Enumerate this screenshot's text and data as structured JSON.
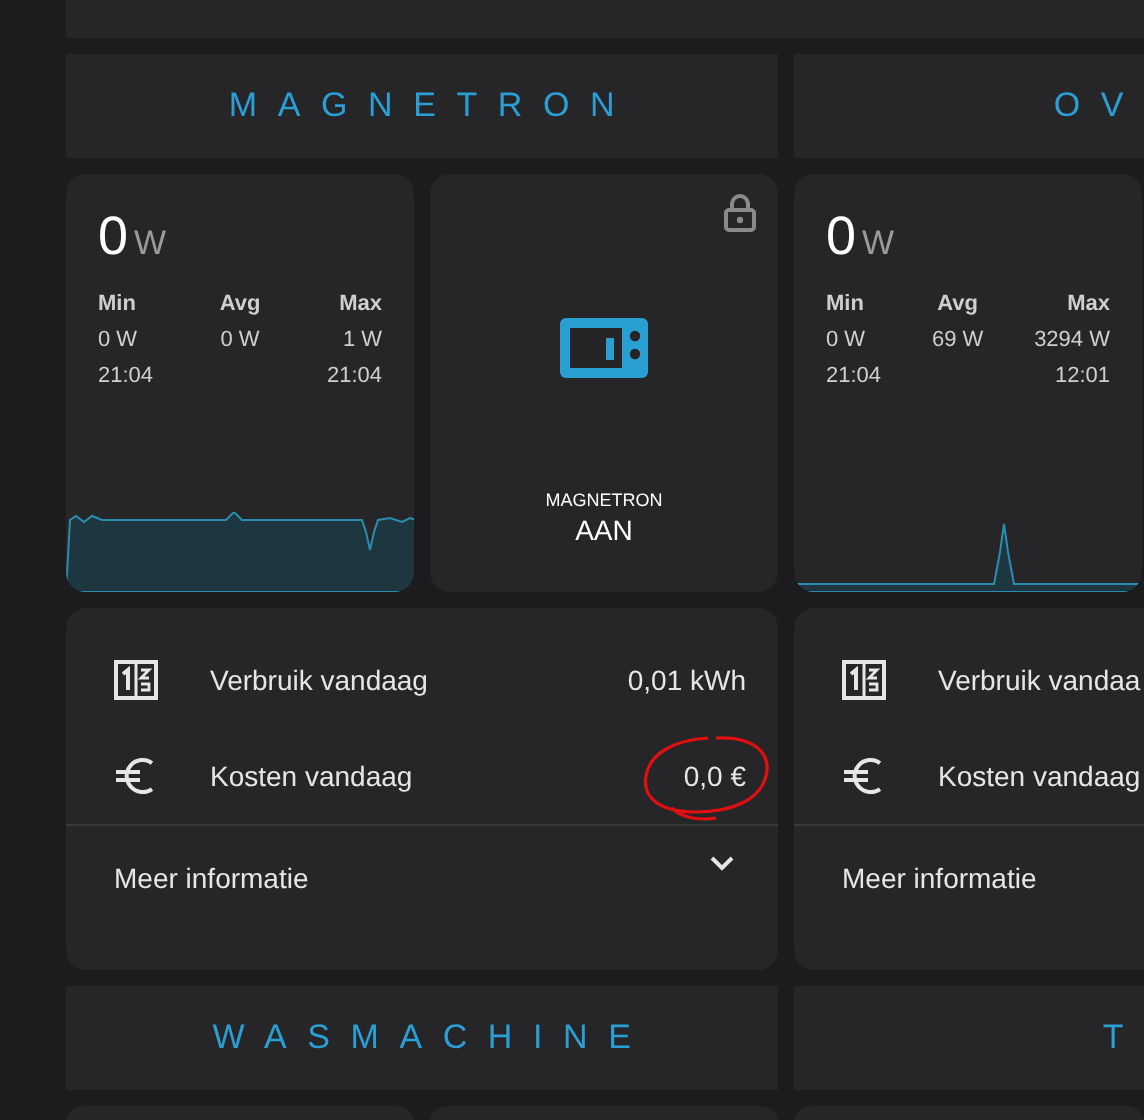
{
  "columns": [
    {
      "header": "MAGNETRON",
      "sensor": {
        "value": "0",
        "unit": "W",
        "graph": {
          "kind": "plateau"
        },
        "stats": [
          {
            "label": "Min",
            "value": "0 W",
            "time": "21:04"
          },
          {
            "label": "Avg",
            "value": "0 W"
          },
          {
            "label": "Max",
            "value": "1 W",
            "time": "21:04"
          }
        ]
      },
      "switch": {
        "name": "MAGNETRON",
        "state": "AAN",
        "on": true,
        "locked": true
      },
      "rows": [
        {
          "kind": "counter",
          "label": "Verbruik vandaag",
          "value": "0,01 kWh"
        },
        {
          "kind": "euro",
          "label": "Kosten vandaag",
          "value": "0,0 €",
          "circled": true
        }
      ],
      "more": "Meer informatie",
      "expanded": false
    },
    {
      "header": "OV",
      "sensor": {
        "value": "0",
        "unit": "W",
        "graph": {
          "kind": "spike"
        },
        "stats": [
          {
            "label": "Min",
            "value": "0 W",
            "time": "21:04"
          },
          {
            "label": "Avg",
            "value": "69 W"
          },
          {
            "label": "Max",
            "value": "3294 W",
            "time": "12:01"
          }
        ]
      },
      "rows": [
        {
          "kind": "counter",
          "label": "Verbruik vandaa"
        },
        {
          "kind": "euro",
          "label": "Kosten vandaag"
        }
      ],
      "more": "Meer informatie"
    }
  ],
  "next_headers": [
    "WASMACHINE",
    "T"
  ]
}
